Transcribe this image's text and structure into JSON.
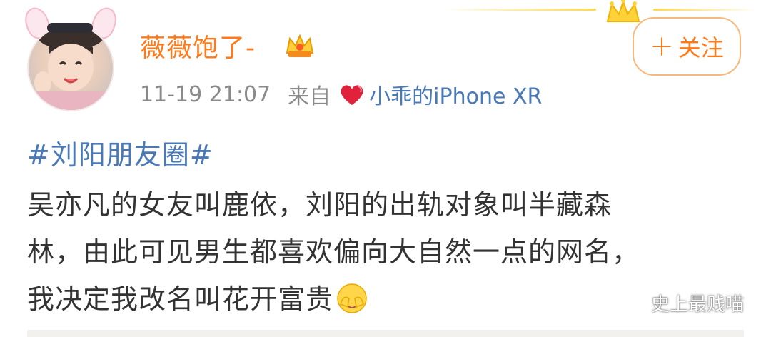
{
  "post": {
    "username": "薇薇饱了-",
    "time": "11-19 21:07",
    "from_label": "来自",
    "source": "小乖的iPhone XR",
    "follow_plus": "+",
    "follow_label": "关注",
    "hashtag": "#刘阳朋友圈#",
    "lines": [
      "吴亦凡的女友叫鹿依，刘阳的出轨对象叫半藏森",
      "林，由此可见男生都喜欢偏向大自然一点的网名，",
      "我决定我改名叫花开富贵"
    ]
  },
  "watermark": {
    "text": "史上最贱喵"
  },
  "icons": {
    "vip": "crown-badge-icon",
    "source": "heart-icon",
    "emoji": "shy-face-emoji-icon",
    "watermark": "wechat-icon",
    "banner": "crown-icon"
  },
  "colors": {
    "username": "#ff7a1a",
    "link": "#4a79b8",
    "meta": "#8a8a8a",
    "body": "#333333",
    "follow_border": "#f7b87e"
  }
}
